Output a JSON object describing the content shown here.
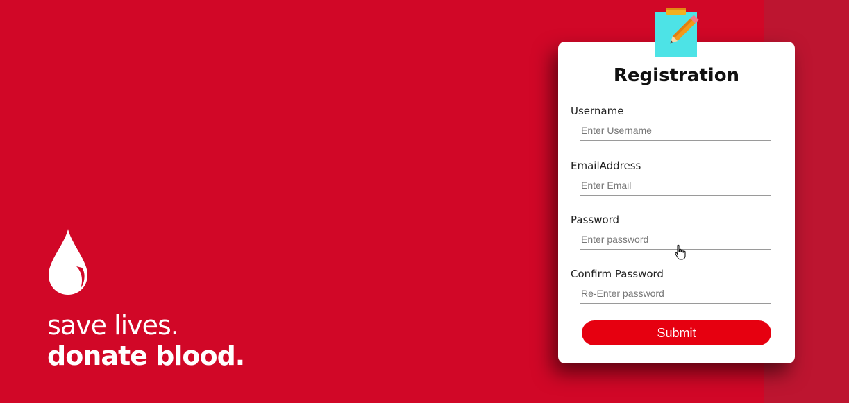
{
  "branding": {
    "tagline_line1": "save lives.",
    "tagline_line2": "donate blood.",
    "icon": "blood-drop-icon"
  },
  "form": {
    "title": "Registration",
    "icon": "note-pencil-icon",
    "fields": [
      {
        "label": "Username",
        "placeholder": "Enter Username",
        "value": ""
      },
      {
        "label": "EmailAddress",
        "placeholder": "Enter Email",
        "value": ""
      },
      {
        "label": "Password",
        "placeholder": "Enter password",
        "value": ""
      },
      {
        "label": "Confirm Password",
        "placeholder": "Re-Enter password",
        "value": ""
      }
    ],
    "submit_label": "Submit"
  },
  "colors": {
    "background": "#d10727",
    "submit": "#e60010",
    "card": "#ffffff",
    "note": "#4de3e6"
  }
}
